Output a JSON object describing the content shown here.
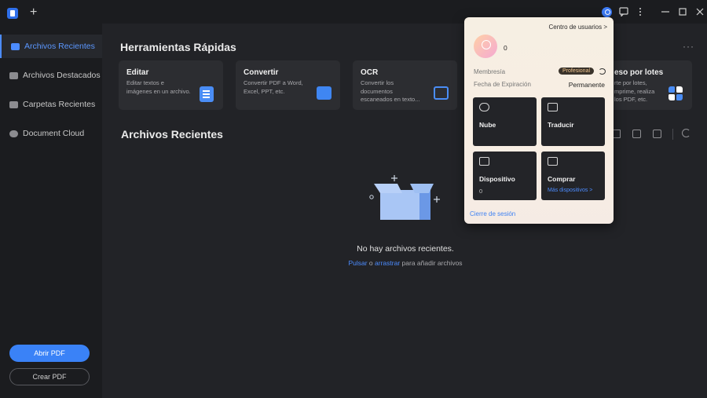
{
  "titlebar": {
    "new_tab": "+",
    "icons": [
      "app-logo-icon",
      "avatar-icon",
      "feedback-icon",
      "more-vertical-icon",
      "minimize-icon",
      "maximize-icon",
      "close-icon"
    ]
  },
  "sidebar": {
    "items": [
      {
        "label": "Archivos Recientes",
        "icon": "recent-files-icon",
        "active": true
      },
      {
        "label": "Archivos Destacados",
        "icon": "starred-files-icon",
        "active": false
      },
      {
        "label": "Carpetas Recientes",
        "icon": "folder-icon",
        "active": false
      },
      {
        "label": "Document Cloud",
        "icon": "cloud-icon",
        "active": false
      }
    ],
    "open_pdf": "Abrir PDF",
    "create_pdf": "Crear PDF"
  },
  "quick_tools": {
    "title": "Herramientas Rápidas",
    "cards": [
      {
        "title": "Editar",
        "desc": "Editar textos e imágenes en un archivo.",
        "icon": "edit-doc-icon"
      },
      {
        "title": "Convertir",
        "desc": "Convertir PDF a Word, Excel, PPT, etc.",
        "icon": "convert-icon"
      },
      {
        "title": "OCR",
        "desc": "Convertir los documentos escaneados en texto...",
        "icon": "ocr-icon"
      },
      {
        "title": "eso por lotes",
        "desc": "rte por lotes, mprime, realiza los PDF, etc.",
        "icon": "batch-icon"
      }
    ]
  },
  "recent": {
    "title": "Archivos Recientes",
    "empty_text": "No hay archivos recientes.",
    "hint_click": "Pulsar",
    "hint_or": "o",
    "hint_drag": "arrastrar",
    "hint_rest": "para añadir archivos"
  },
  "popover": {
    "user_center": "Centro de usuarios >",
    "count": "0",
    "membership_label": "Membresía",
    "membership_badge": "Profesional",
    "expiry_label": "Fecha de Expiración",
    "expiry_value": "Permanente",
    "tiles": [
      {
        "title": "Nube",
        "sub": "",
        "icon": "cloud-upload-icon"
      },
      {
        "title": "Traducir",
        "sub": "",
        "icon": "translate-icon"
      },
      {
        "title": "Dispositivo",
        "sub": "0",
        "icon": "monitor-icon"
      },
      {
        "title": "Comprar",
        "link": "Más dispositivos >",
        "icon": "cart-icon"
      }
    ],
    "logout": "Cierre de sesión"
  },
  "colors": {
    "accent": "#3a82f7",
    "sidebar_bg": "#1b1c1f",
    "main_bg": "#222327",
    "popover_bg": "#f6efe3"
  }
}
